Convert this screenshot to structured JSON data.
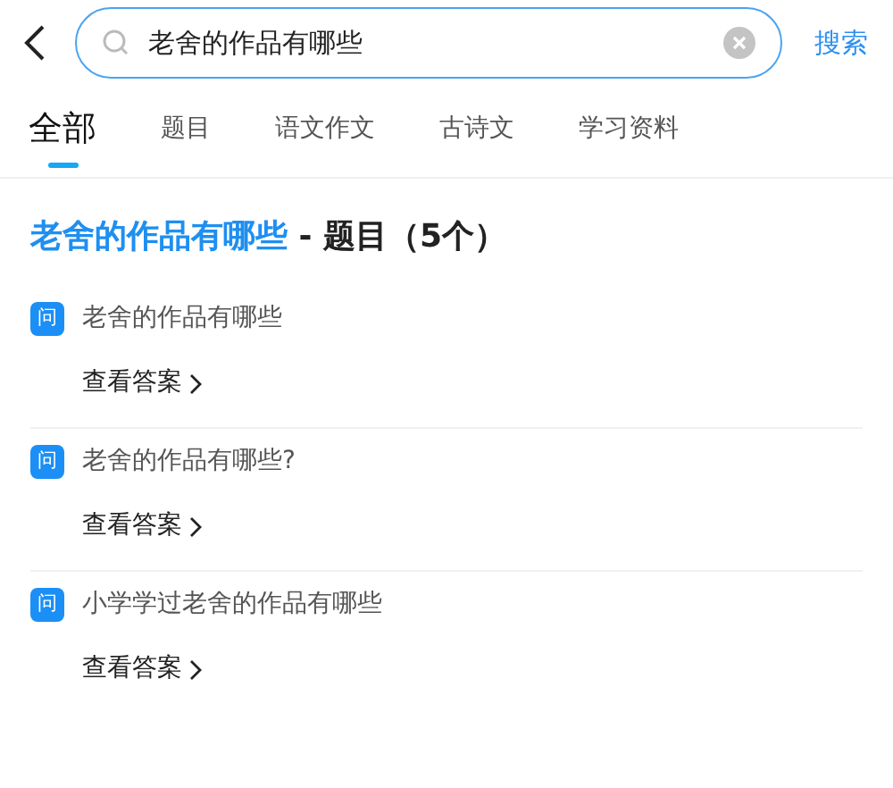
{
  "search": {
    "value": "老舍的作品有哪些",
    "action": "搜索"
  },
  "tabs": [
    {
      "label": "全部",
      "selected": true
    },
    {
      "label": "题目",
      "selected": false
    },
    {
      "label": "语文作文",
      "selected": false
    },
    {
      "label": "古诗文",
      "selected": false
    },
    {
      "label": "学习资料",
      "selected": false
    }
  ],
  "heading": {
    "query": "老舍的作品有哪些",
    "suffix": "- 题目（5个）"
  },
  "questions": [
    {
      "badge": "问",
      "text": "老舍的作品有哪些",
      "link": "查看答案"
    },
    {
      "badge": "问",
      "text": "老舍的作品有哪些?",
      "link": "查看答案"
    },
    {
      "badge": "问",
      "text": "小学学过老舍的作品有哪些",
      "link": "查看答案"
    }
  ]
}
